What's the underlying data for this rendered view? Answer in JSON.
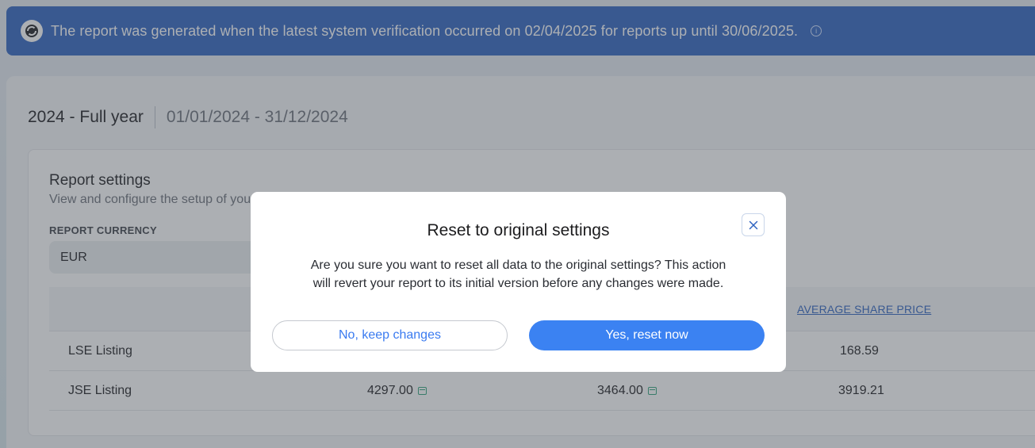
{
  "banner": {
    "text": "The report was generated when the latest system verification occurred on 02/04/2025 for reports up until 30/06/2025.",
    "logo_icon": "sync-logo-icon",
    "info_icon": "info-icon"
  },
  "period": {
    "title": "2024 - Full year",
    "range": "01/01/2024 - 31/12/2024"
  },
  "settings": {
    "title": "Report settings",
    "subtitle": "View and configure the setup of you",
    "currency_label": "REPORT CURRENCY",
    "currency_value": "EUR"
  },
  "table": {
    "headers": [
      "AVERAGE SHARE PRICE"
    ],
    "rows": [
      {
        "name": "LSE Listing",
        "avg": "168.59"
      },
      {
        "name": "JSE Listing",
        "col1": "4297.00",
        "col2": "3464.00",
        "avg": "3919.21"
      }
    ]
  },
  "modal": {
    "title": "Reset to original settings",
    "message": "Are you sure you want to reset all data to the original settings? This action will revert your report to its initial version before any changes were made.",
    "cancel_label": "No, keep changes",
    "confirm_label": "Yes, reset now",
    "close_icon": "close-icon"
  },
  "colors": {
    "banner_bg": "#2e63c0",
    "primary_button": "#3b82f2",
    "link": "#2e63c0",
    "calendar_icon": "#2fa37a"
  }
}
